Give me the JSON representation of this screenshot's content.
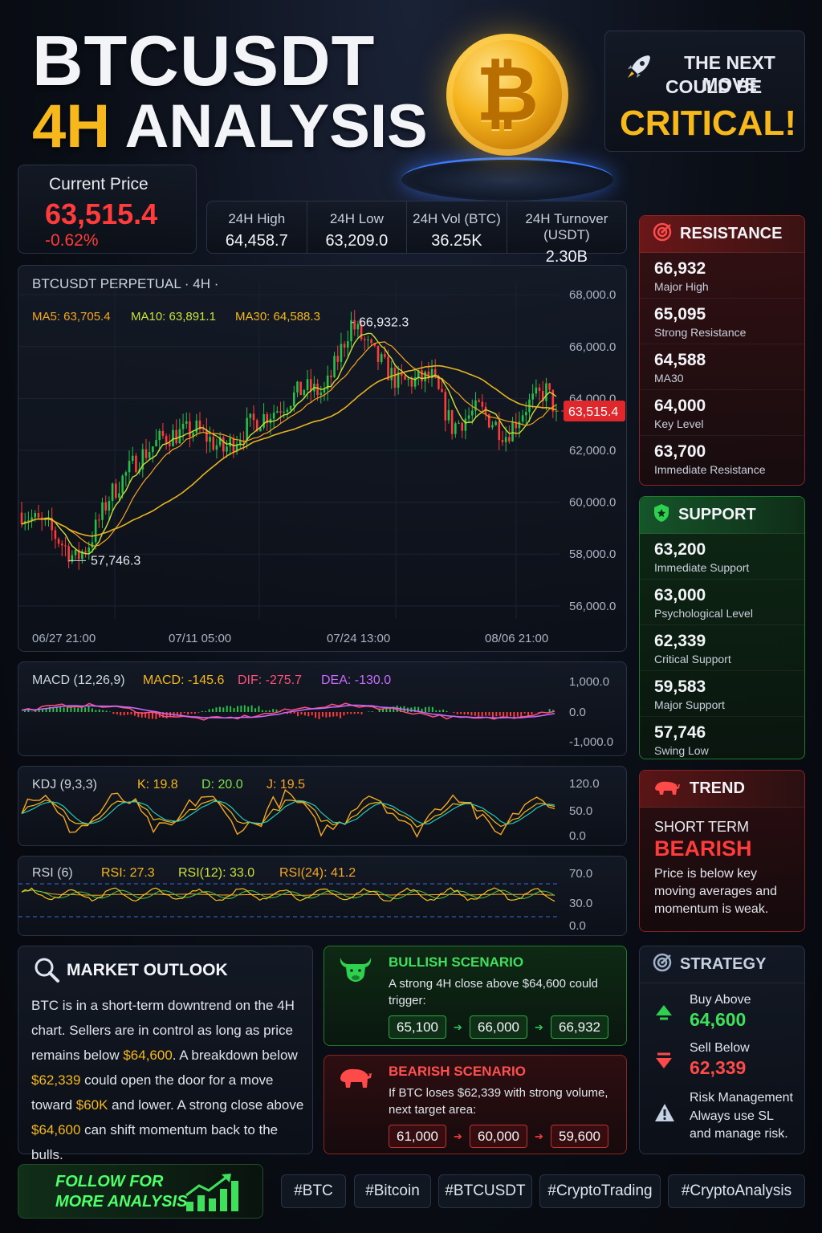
{
  "header": {
    "title_line1": "BTCUSDT",
    "title_gold": "4H",
    "title_rest": "ANALYSIS",
    "coin_symbol": "₿",
    "next_move_l1": "THE NEXT MOVE",
    "next_move_l2": "COULD BE",
    "next_move_l3": "CRITICAL!"
  },
  "current_price": {
    "label": "Current Price",
    "value": "63,515.4",
    "change": "-0.62%"
  },
  "stats": [
    {
      "label": "24H High",
      "value": "64,458.7"
    },
    {
      "label": "24H Low",
      "value": "63,209.0"
    },
    {
      "label": "24H Vol (BTC)",
      "value": "36.25K"
    },
    {
      "label": "24H Turnover (USDT)",
      "value": "2.30B"
    }
  ],
  "main_chart": {
    "title": "BTCUSDT PERPETUAL · 4H ·",
    "ma5": "MA5: 63,705.4",
    "ma10": "MA10: 63,891.1",
    "ma30": "MA30: 64,588.3",
    "high_label": "66,932.3",
    "low_label": "57,746.3",
    "price_tag": "63,515.4",
    "xticks": [
      "06/27 21:00",
      "07/11 05:00",
      "07/24  13:00",
      "08/06  21:00"
    ]
  },
  "macd": {
    "title": "MACD (12,26,9)",
    "macd": "MACD: -145.6",
    "dif": "DIF: -275.7",
    "dea": "DEA: -130.0",
    "yticks": [
      "1,000.0",
      "0.0",
      "-1,000.0"
    ]
  },
  "kdj": {
    "title": "KDJ (9,3,3)",
    "k": "K: 19.8",
    "d": "D: 20.0",
    "j": "J: 19.5",
    "yticks": [
      "120.0",
      "50.0",
      "0.0"
    ]
  },
  "rsi": {
    "title": "RSI (6)",
    "rsi": "RSI: 27.3",
    "rsi12": "RSI(12): 33.0",
    "rsi24": "RSI(24): 41.2",
    "yticks": [
      "70.0",
      "30.0",
      "0.0"
    ]
  },
  "resistance": {
    "title": "RESISTANCE",
    "levels": [
      {
        "price": "66,932",
        "desc": "Major High"
      },
      {
        "price": "65,095",
        "desc": "Strong Resistance"
      },
      {
        "price": "64,588",
        "desc": "MA30"
      },
      {
        "price": "64,000",
        "desc": "Key Level"
      },
      {
        "price": "63,700",
        "desc": "Immediate Resistance"
      }
    ]
  },
  "support": {
    "title": "SUPPORT",
    "levels": [
      {
        "price": "63,200",
        "desc": "Immediate Support"
      },
      {
        "price": "63,000",
        "desc": "Psychological Level"
      },
      {
        "price": "62,339",
        "desc": "Critical Support"
      },
      {
        "price": "59,583",
        "desc": "Major Support"
      },
      {
        "price": "57,746",
        "desc": "Swing Low"
      }
    ]
  },
  "trend": {
    "title": "TREND",
    "term": "SHORT TERM",
    "direction": "BEARISH",
    "desc": "Price is below key moving averages and momentum is weak."
  },
  "outlook": {
    "title": "MARKET OUTLOOK",
    "p1": "BTC is in a short-term downtrend on the 4H chart. Sellers are in control as long as price remains below ",
    "h1": "$64,600",
    "p2": ". A breakdown below ",
    "h2": "$62,339",
    "p3": " could open the door for a move toward ",
    "h3": "$60K",
    "p4": " and lower. A strong close above ",
    "h4": "$64,600",
    "p5": " can shift momentum back to the bulls."
  },
  "bullish": {
    "title": "BULLISH SCENARIO",
    "text": "A strong 4H close above $64,600 could trigger:",
    "targets": [
      "65,100",
      "66,000",
      "66,932"
    ]
  },
  "bearish": {
    "title": "BEARISH SCENARIO",
    "text": "If BTC loses $62,339 with strong volume, next target area:",
    "targets": [
      "61,000",
      "60,000",
      "59,600"
    ]
  },
  "strategy": {
    "title": "STRATEGY",
    "buy_label": "Buy Above",
    "buy_value": "64,600",
    "sell_label": "Sell Below",
    "sell_value": "62,339",
    "risk_title": "Risk Management",
    "risk_l2": "Always use SL",
    "risk_l3": "and manage risk."
  },
  "follow": {
    "line1": "FOLLOW FOR",
    "line2": "MORE ANALYSIS"
  },
  "hashtags": [
    "#BTC",
    "#Bitcoin",
    "#BTCUSDT",
    "#CryptoTrading",
    "#CryptoAnalysis"
  ],
  "colors": {
    "up": "#26c04b",
    "down": "#ff3b3b",
    "gold": "#f6b81a",
    "panel": "#121824"
  },
  "chart_data": {
    "type": "candlestick",
    "title": "BTCUSDT PERPETUAL · 4H ·",
    "ylim": [
      55500,
      68500
    ],
    "yticks": [
      68000,
      66000,
      64000,
      62000,
      60000,
      58000,
      56000
    ],
    "xticks": [
      "06/27 21:00",
      "07/11 05:00",
      "07/24  13:00",
      "08/06  21:00"
    ],
    "candle_count": 160,
    "key_points": [
      {
        "label": "low",
        "value": 57746.3
      },
      {
        "label": "high",
        "value": 66932.3
      },
      {
        "label": "last",
        "value": 63515.4
      }
    ],
    "close_path": [
      [
        0,
        59600
      ],
      [
        8,
        59000
      ],
      [
        16,
        57800
      ],
      [
        20,
        58400
      ],
      [
        26,
        60200
      ],
      [
        34,
        61600
      ],
      [
        42,
        62500
      ],
      [
        52,
        62800
      ],
      [
        60,
        62000
      ],
      [
        68,
        63000
      ],
      [
        76,
        63600
      ],
      [
        84,
        64400
      ],
      [
        90,
        64200
      ],
      [
        98,
        66900
      ],
      [
        104,
        65800
      ],
      [
        112,
        64600
      ],
      [
        122,
        64800
      ],
      [
        128,
        62900
      ],
      [
        136,
        63600
      ],
      [
        144,
        62600
      ],
      [
        150,
        63700
      ],
      [
        156,
        64300
      ],
      [
        159,
        63515
      ]
    ],
    "series": [
      {
        "name": "MA5",
        "value": 63705.4
      },
      {
        "name": "MA10",
        "value": 63891.1
      },
      {
        "name": "MA30",
        "value": 64588.3
      }
    ],
    "indicators": {
      "macd": {
        "macd": -145.6,
        "dif": -275.7,
        "dea": -130.0,
        "ylim": [
          -1000,
          1000
        ]
      },
      "kdj": {
        "k": 19.8,
        "d": 20.0,
        "j": 19.5,
        "ylim": [
          0,
          120
        ]
      },
      "rsi": {
        "rsi6": 27.3,
        "rsi12": 33.0,
        "rsi24": 41.2,
        "ylim": [
          0,
          70
        ]
      }
    }
  }
}
